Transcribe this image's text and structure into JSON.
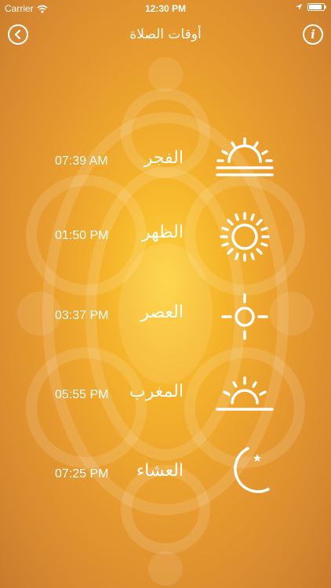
{
  "status_bar": {
    "carrier": "Carrier",
    "time": "12:30 PM",
    "battery_level": 0.9
  },
  "nav": {
    "title": "أوقات الصلاة",
    "info_label": "i"
  },
  "prayers": [
    {
      "name": "الفجر",
      "time": "07:39 AM",
      "icon": "sunrise-icon"
    },
    {
      "name": "الظهر",
      "time": "01:50 PM",
      "icon": "sun-icon"
    },
    {
      "name": "العصر",
      "time": "03:37 PM",
      "icon": "small-sun-icon"
    },
    {
      "name": "المغرب",
      "time": "05:55 PM",
      "icon": "sunset-icon"
    },
    {
      "name": "العشاء",
      "time": "07:25 PM",
      "icon": "moon-star-icon"
    }
  ],
  "colors": {
    "background_center": "#ffd23a",
    "background_edge": "#c97b2c",
    "foreground": "#ffffff"
  }
}
